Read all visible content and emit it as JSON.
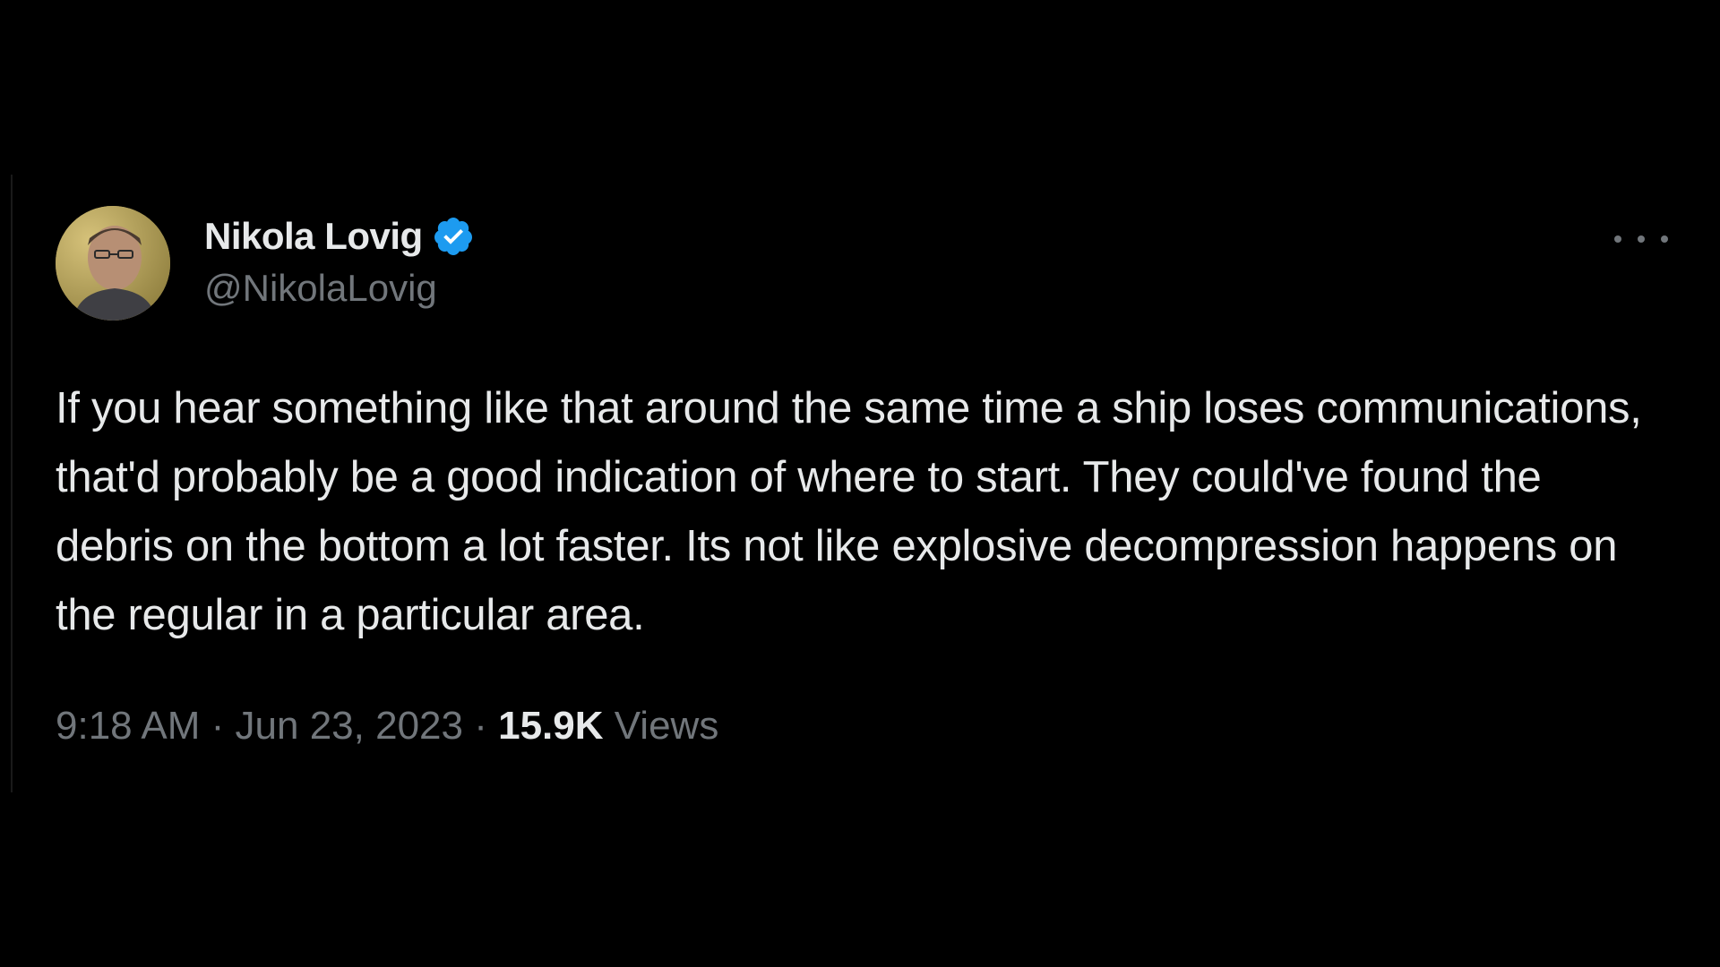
{
  "author": {
    "display_name": "Nikola Lovig",
    "handle": "@NikolaLovig",
    "verified": true,
    "verified_color": "#1d9bf0"
  },
  "tweet": {
    "text": "If you hear something like that around the same time a ship loses communications, that'd probably be a good indication of where to start. They could've found the debris on the bottom a lot faster. Its not like explosive decompression happens on the regular in a particular area.",
    "time": "9:18 AM",
    "separator": " · ",
    "date": "Jun 23, 2023",
    "views_count": "15.9K",
    "views_label": " Views"
  },
  "icons": {
    "verified": "verified-badge-icon",
    "more": "more-options-icon"
  },
  "colors": {
    "background": "#000000",
    "primary_text": "#e7e9ea",
    "secondary_text": "#71767b"
  }
}
